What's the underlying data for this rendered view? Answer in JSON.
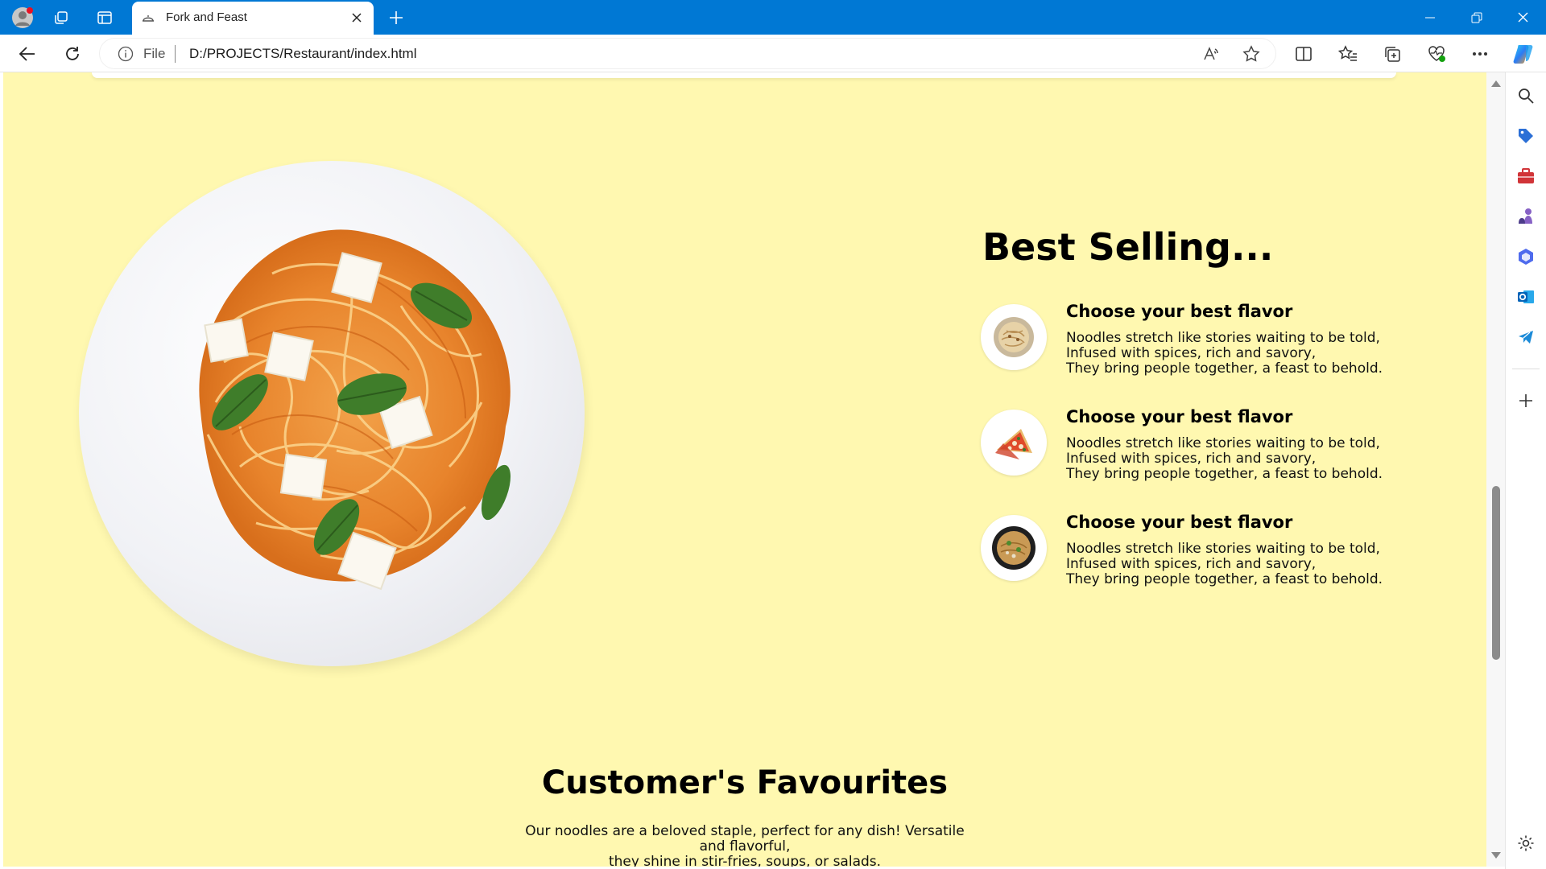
{
  "browser": {
    "tab_title": "Fork and Feast",
    "address_scheme": "File",
    "address_url": "D:/PROJECTS/Restaurant/index.html",
    "accent_color": "#0078d4"
  },
  "page": {
    "background_color": "#fff8b0",
    "best_selling": {
      "title": "Best Selling...",
      "items": [
        {
          "heading": "Choose your best flavor",
          "line1": "Noodles stretch like stories waiting to be told,",
          "line2": "Infused with spices, rich and savory,",
          "line3": "They bring people together, a feast to behold.",
          "image": "noodle-bowl"
        },
        {
          "heading": "Choose your best flavor",
          "line1": "Noodles stretch like stories waiting to be told,",
          "line2": "Infused with spices, rich and savory,",
          "line3": "They bring people together, a feast to behold.",
          "image": "pizza-slices"
        },
        {
          "heading": "Choose your best flavor",
          "line1": "Noodles stretch like stories waiting to be told,",
          "line2": "Infused with spices, rich and savory,",
          "line3": "They bring people together, a feast to behold.",
          "image": "fried-noodle-bowl"
        }
      ]
    },
    "hero_image": "spaghetti-plate",
    "customers": {
      "title": "Customer's Favourites",
      "line1": "Our noodles are a beloved staple, perfect for any dish! Versatile and flavorful,",
      "line2": "they shine in stir-fries, soups, or salads."
    }
  }
}
